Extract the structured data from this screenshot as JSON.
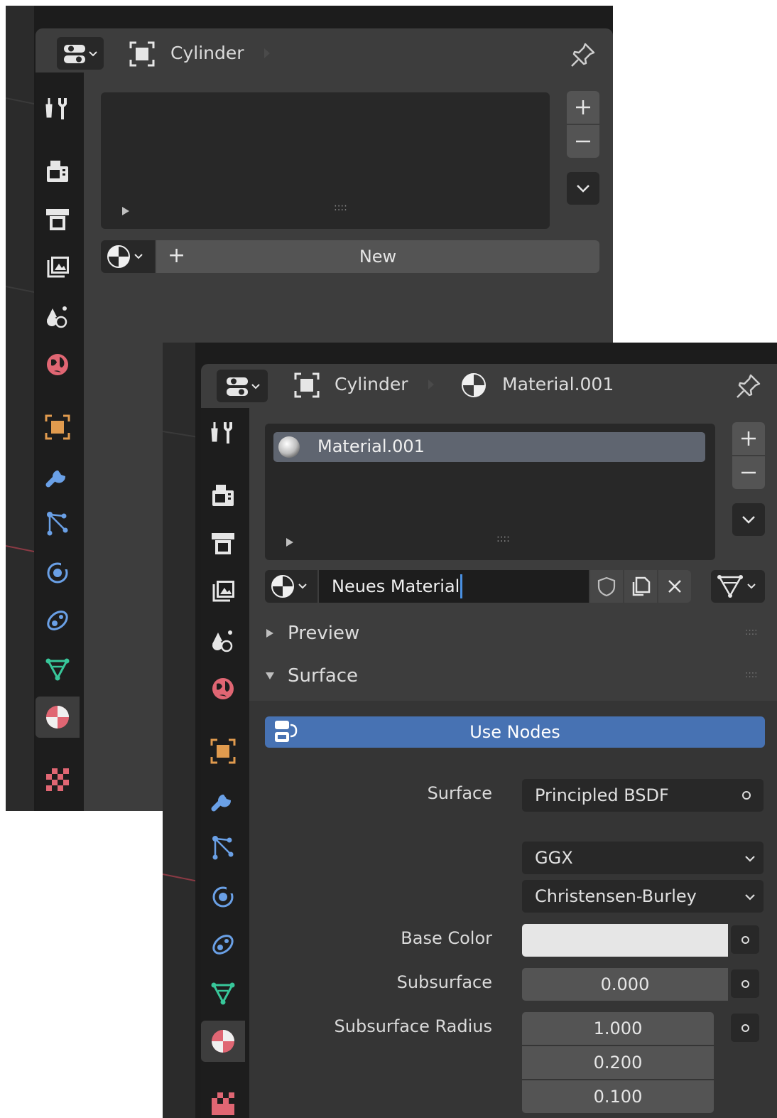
{
  "back_window": {
    "breadcrumb_object": "Cylinder",
    "new_button_label": "New",
    "new_button_plus": "+",
    "slot_list_resize": "::::"
  },
  "front_window": {
    "breadcrumb_object": "Cylinder",
    "breadcrumb_material": "Material.001",
    "slot_item_label": "Material.001",
    "slot_list_resize": "::::",
    "material_name_value": "Neues Material",
    "panels": {
      "preview_label": "Preview",
      "surface_label": "Surface"
    },
    "use_nodes_label": "Use Nodes",
    "properties": {
      "surface_label": "Surface",
      "surface_value": "Principled BSDF",
      "distribution_value": "GGX",
      "subsurface_method_value": "Christensen-Burley",
      "base_color_label": "Base Color",
      "base_color_value": "#e6e6e6",
      "subsurface_label": "Subsurface",
      "subsurface_value": "0.000",
      "subsurface_radius_label": "Subsurface Radius",
      "subsurface_radius_values": [
        "1.000",
        "0.200",
        "0.100"
      ]
    }
  },
  "icons": [
    "editor-type-icon",
    "object-icon",
    "pin-icon",
    "tool-icon",
    "render-icon",
    "output-icon",
    "view-layer-icon",
    "scene-icon",
    "world-icon",
    "object-props-icon",
    "modifier-icon",
    "particles-icon",
    "physics-icon",
    "constraints-icon",
    "data-icon",
    "material-icon",
    "texture-icon",
    "add-icon",
    "remove-icon",
    "chevron-down-icon",
    "fake-user-icon",
    "duplicate-icon",
    "close-icon",
    "node-link-icon"
  ],
  "colors": {
    "accent_blue": "#4772b3",
    "panel_bg": "#3d3d3d",
    "window_bg": "#2b2b2b",
    "field_bg": "#282828",
    "slot_selected": "#5f6570"
  }
}
